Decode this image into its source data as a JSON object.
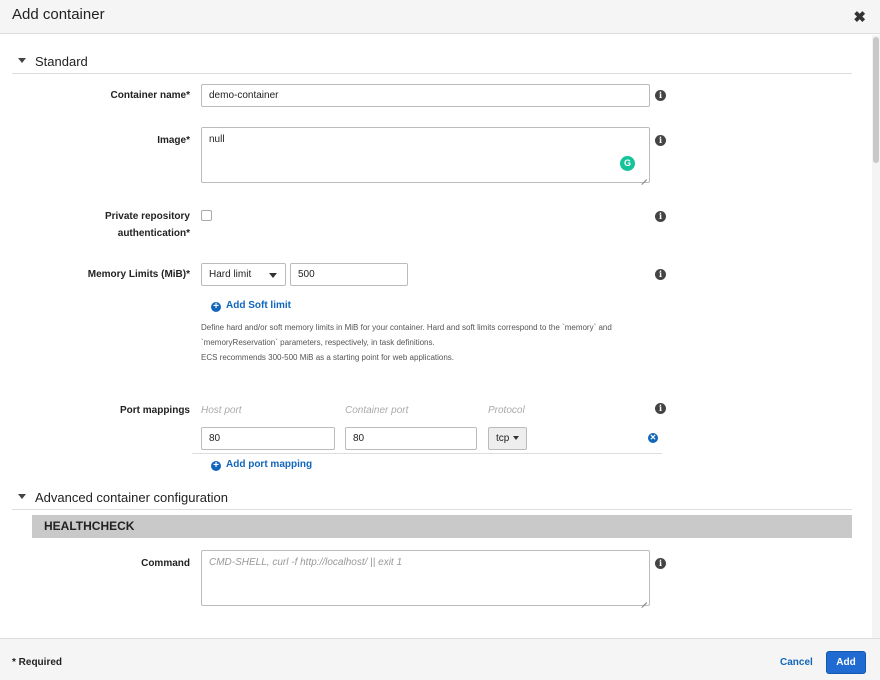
{
  "dialog": {
    "title": "Add container",
    "close_icon": "close-icon"
  },
  "sections": {
    "standard": {
      "label": "Standard"
    },
    "advanced": {
      "label": "Advanced container configuration"
    }
  },
  "fields": {
    "container_name": {
      "label": "Container name*",
      "value": "demo-container"
    },
    "image": {
      "label": "Image*",
      "value": "null"
    },
    "private_repo": {
      "label_line1": "Private repository",
      "label_line2": "authentication*",
      "checked": false
    },
    "memory": {
      "label": "Memory Limits (MiB)*",
      "limit_type": "Hard limit",
      "value": "500",
      "add_soft_limit": "Add Soft limit",
      "help_lines": [
        "Define hard and/or soft memory limits in MiB for your container. Hard and soft limits correspond to the `memory` and",
        "`memoryReservation` parameters, respectively, in task definitions.",
        "ECS recommends 300-500 MiB as a starting point for web applications."
      ]
    },
    "port_mappings": {
      "label": "Port mappings",
      "columns": [
        "Host port",
        "Container port",
        "Protocol"
      ],
      "rows": [
        {
          "host_port": "80",
          "container_port": "80",
          "protocol": "tcp"
        }
      ],
      "add_label": "Add port mapping"
    }
  },
  "healthcheck": {
    "title": "HEALTHCHECK",
    "command_label": "Command",
    "command_placeholder": "CMD-SHELL, curl -f http://localhost/ || exit 1"
  },
  "footer": {
    "required_note": "* Required",
    "cancel_label": "Cancel",
    "add_label": "Add"
  },
  "colors": {
    "link": "#1166bb",
    "primary": "#1f6bd1",
    "band": "#c9c9c9"
  }
}
